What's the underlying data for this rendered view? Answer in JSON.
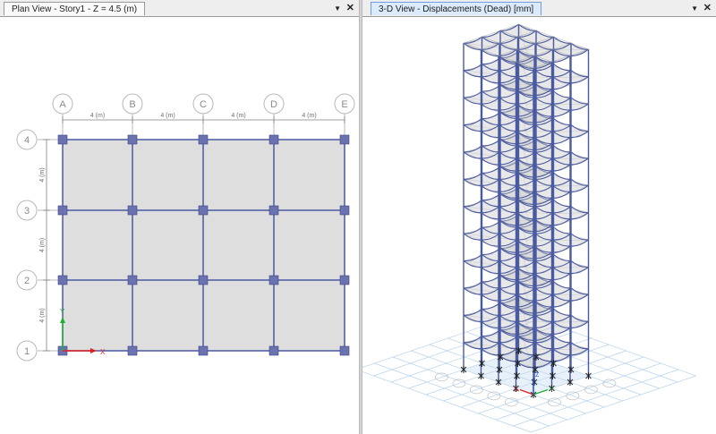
{
  "left_view": {
    "tab_title": "Plan View - Story1 - Z = 4.5 (m)",
    "menu_icon": "dropdown-arrow-icon",
    "close_icon": "close-icon",
    "grid_x_labels": [
      "A",
      "B",
      "C",
      "D",
      "E"
    ],
    "grid_y_labels": [
      "1",
      "2",
      "3",
      "4"
    ],
    "bay_dimensions_x": [
      "4 (m)",
      "4 (m)",
      "4 (m)",
      "4 (m)"
    ],
    "bay_dimensions_y": [
      "4 (m)",
      "4 (m)",
      "4 (m)"
    ],
    "axis_x_label": "X",
    "axis_y_label": "Y"
  },
  "right_view": {
    "tab_title": "3-D View   - Displacements (Dead)  [mm]",
    "menu_icon": "dropdown-arrow-icon",
    "close_icon": "close-icon",
    "axis_x_label": "X",
    "axis_y_label": "Y",
    "axis_z_label": "Z"
  },
  "colors": {
    "frame": "#4a5aa0",
    "slab": "#dedede",
    "column_marker": "#6a72b0",
    "bubble": "#b8b8b8",
    "dimension": "#808080",
    "axis_x": "#e02020",
    "axis_y": "#20b030",
    "axis_z": "#2050e0",
    "ground_grid": "#b8d4ec"
  }
}
